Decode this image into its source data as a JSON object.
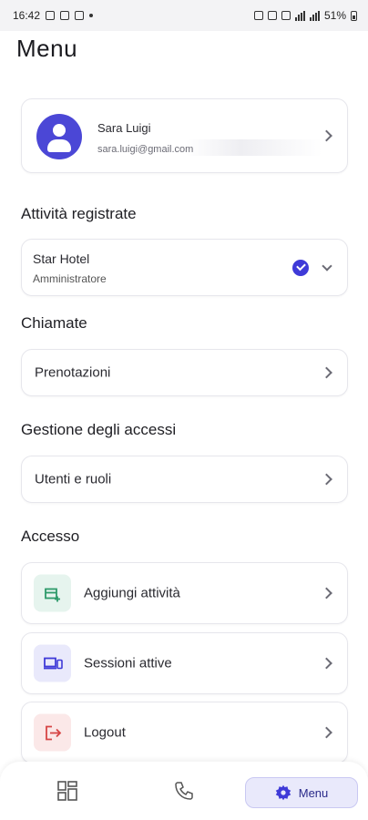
{
  "status_bar": {
    "time": "16:42",
    "battery": "51%"
  },
  "page": {
    "title": "Menu"
  },
  "profile": {
    "name": "Sara Luigi",
    "email": "sara.luigi@gmail.com"
  },
  "sections": {
    "registered": "Attività registrate",
    "calls": "Chiamate",
    "access_management": "Gestione degli accessi",
    "access": "Accesso"
  },
  "activity": {
    "name": "Star Hotel",
    "role": "Amministratore"
  },
  "rows": {
    "bookings": "Prenotazioni",
    "users_roles": "Utenti e ruoli"
  },
  "access_items": [
    {
      "label": "Aggiungi attività",
      "icon": "add-business-icon",
      "bg": "#e6f4ee",
      "color": "#2e9a6a"
    },
    {
      "label": "Sessioni attive",
      "icon": "devices-icon",
      "bg": "#e9e9fb",
      "color": "#3f3ad8"
    },
    {
      "label": "Logout",
      "icon": "logout-icon",
      "bg": "#fbe8e8",
      "color": "#d64545"
    }
  ],
  "bottom_nav": {
    "active_label": "Menu",
    "accent": "#3f3ad8"
  }
}
